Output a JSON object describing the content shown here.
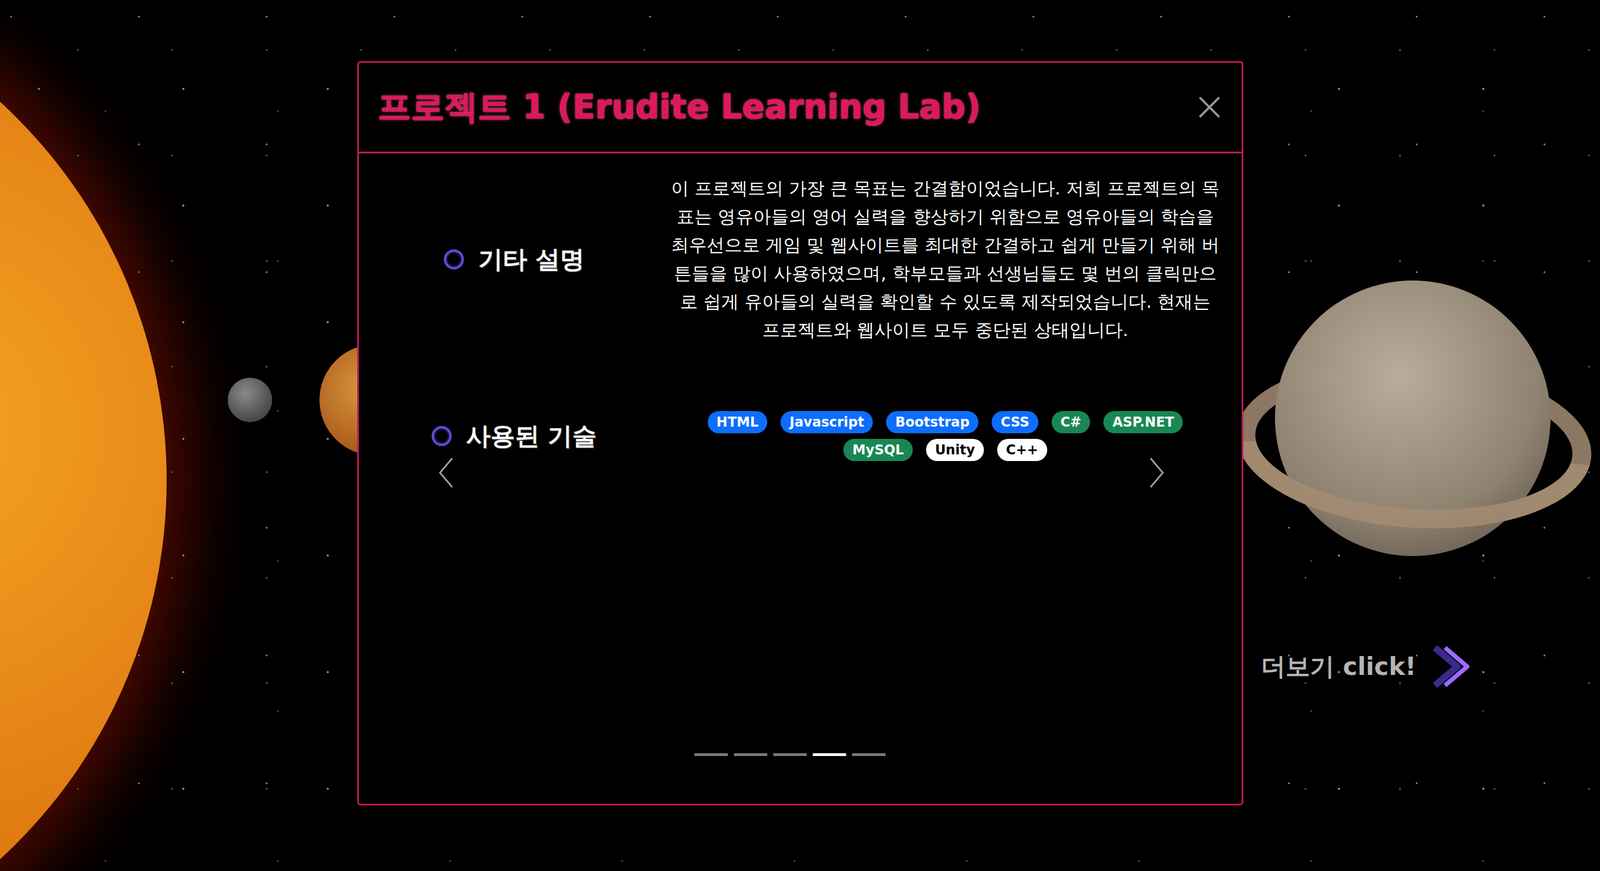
{
  "page": {
    "more_link": "더보기 click!"
  },
  "modal": {
    "title": "프로젝트 1 (Erudite Learning Lab)",
    "description": {
      "label": "기타 설명",
      "text": "이 프로젝트의 가장 큰 목표는 간결함이었습니다. 저희 프로젝트의 목표는 영유아들의 영어 실력을 향상하기 위함으로 영유아들의 학습을 최우선으로 게임 및 웹사이트를 최대한 간결하고 쉽게 만들기 위해 버튼들을 많이 사용하였으며, 학부모들과 선생님들도 몇 번의 클릭만으로 쉽게 유아들의 실력을 확인할 수 있도록 제작되었습니다. 현재는 프로젝트와 웹사이트 모두 중단된 상태입니다."
    },
    "technologies": {
      "label": "사용된 기술",
      "tags": [
        {
          "label": "HTML",
          "color": "#0d6efd"
        },
        {
          "label": "Javascript",
          "color": "#0d6efd"
        },
        {
          "label": "Bootstrap",
          "color": "#0d6efd"
        },
        {
          "label": "CSS",
          "color": "#0d6efd"
        },
        {
          "label": "C#",
          "color": "#198754"
        },
        {
          "label": "ASP.NET",
          "color": "#198754"
        },
        {
          "label": "MySQL",
          "color": "#198754"
        },
        {
          "label": "Unity",
          "color": "#ffffff"
        },
        {
          "label": "C++",
          "color": "#ffffff"
        }
      ]
    },
    "indicators": [
      {
        "selected": false
      },
      {
        "selected": false
      },
      {
        "selected": false
      },
      {
        "selected": true
      },
      {
        "selected": false
      }
    ]
  }
}
